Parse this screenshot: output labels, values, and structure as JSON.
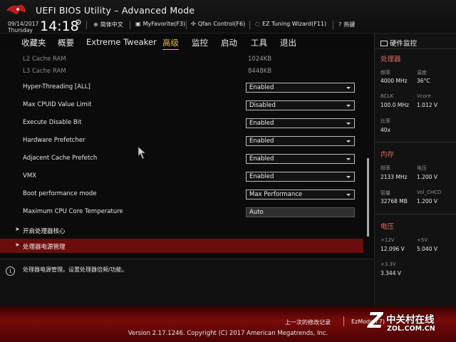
{
  "header": {
    "title": "UEFI BIOS Utility – Advanced Mode",
    "date": "09/14/2017",
    "day": "Thursday",
    "time": "14:18",
    "items": [
      {
        "icon": "globe-icon",
        "label": "简体中文"
      },
      {
        "icon": "favorite-icon",
        "label": "MyFavorite(F3)"
      },
      {
        "icon": "fan-icon",
        "label": "Qfan Control(F6)"
      },
      {
        "icon": "tuning-icon",
        "label": "EZ Tuning Wizard(F11)"
      },
      {
        "icon": "hotkey-icon",
        "label": "热键"
      }
    ]
  },
  "tabs": [
    "收藏夹",
    "概要",
    "Extreme Tweaker",
    "高级",
    "监控",
    "启动",
    "工具",
    "退出"
  ],
  "active_tab": "高级",
  "settings": {
    "info_rows": [
      {
        "label": "L2 Cache RAM",
        "value": "1024KB"
      },
      {
        "label": "L3 Cache RAM",
        "value": "8448KB"
      }
    ],
    "options": [
      {
        "label": "Hyper-Threading [ALL]",
        "value": "Enabled"
      },
      {
        "label": "Max CPUID Value Limit",
        "value": "Disabled"
      },
      {
        "label": "Execute Disable Bit",
        "value": "Enabled"
      },
      {
        "label": "Hardware Prefetcher",
        "value": "Enabled"
      },
      {
        "label": "Adjacent Cache Prefetch",
        "value": "Enabled"
      },
      {
        "label": "VMX",
        "value": "Enabled"
      },
      {
        "label": "Boot performance mode",
        "value": "Max Performance"
      }
    ],
    "text_option": {
      "label": "Maximum CPU Core Temperature",
      "value": "Auto"
    },
    "submenus": [
      "开启处理器核心",
      "处理器电源管理"
    ]
  },
  "help": {
    "text": "处理器电源管理。设置处理器倍频/功能。"
  },
  "hw_monitor": {
    "title": "硬件监控",
    "cpu": {
      "section": "处理器",
      "freq_label": "频率",
      "freq": "4000 MHz",
      "temp_label": "温度",
      "temp": "36°C",
      "bclk_label": "BCLK",
      "bclk": "100.0 MHz",
      "vcore_label": "Vcore",
      "vcore": "1.012 V",
      "ratio_label": "比率",
      "ratio": "40x"
    },
    "memory": {
      "section": "内存",
      "freq_label": "频率",
      "freq": "2133 MHz",
      "volt_label": "电压",
      "volt": "1.200 V",
      "cap_label": "容量",
      "cap": "32768 MB",
      "chcd_label": "Vol_CHCD",
      "chcd": "1.200 V"
    },
    "voltage": {
      "section": "电压",
      "v12_label": "+12V",
      "v12": "12.096 V",
      "v5_label": "+5V",
      "v5": "5.040 V",
      "v33_label": "+3.3V",
      "v33": "3.344 V"
    }
  },
  "footer": {
    "last_modified": "上一次的修改记录",
    "ez_mode": "EzMode(F7)",
    "copyright": "Version 2.17.1246. Copyright (C) 2017 American Megatrends, Inc."
  },
  "watermark": {
    "cn": "中关村在线",
    "en": "ZOL.COM.CN"
  },
  "colors": {
    "accent": "#e2b84e",
    "section": "#e56a5b",
    "selected_row": "#6b0d0d",
    "footer": "#7a0b0b"
  }
}
